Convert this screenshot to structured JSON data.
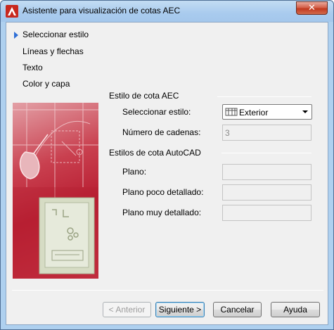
{
  "window": {
    "title": "Asistente para visualización de cotas AEC",
    "close_label": "✕"
  },
  "nav": {
    "items": [
      {
        "label": "Seleccionar estilo",
        "active": true
      },
      {
        "label": "Líneas y flechas",
        "active": false
      },
      {
        "label": "Texto",
        "active": false
      },
      {
        "label": "Color y capa",
        "active": false
      }
    ]
  },
  "aec_group": {
    "title": "Estilo de cota AEC",
    "select_style_label": "Seleccionar estilo:",
    "select_style_value": "Exterior",
    "chain_count_label": "Número de cadenas:",
    "chain_count_value": "3"
  },
  "autocad_group": {
    "title": "Estilos de cota AutoCAD",
    "plan_label": "Plano:",
    "plan_low_label": "Plano poco detallado:",
    "plan_high_label": "Plano muy detallado:"
  },
  "buttons": {
    "back": "< Anterior",
    "next": "Siguiente >",
    "cancel": "Cancelar",
    "help": "Ayuda"
  },
  "colors": {
    "accent": "#2f6fd6",
    "title_bar": "#aed0ef",
    "close": "#c1391f"
  },
  "icons": {
    "app": "autocad-logo-icon",
    "close": "close-icon",
    "nav_active": "triangle-right-icon",
    "combo_style": "dimension-style-icon",
    "combo_dropdown": "chevron-down-icon"
  }
}
